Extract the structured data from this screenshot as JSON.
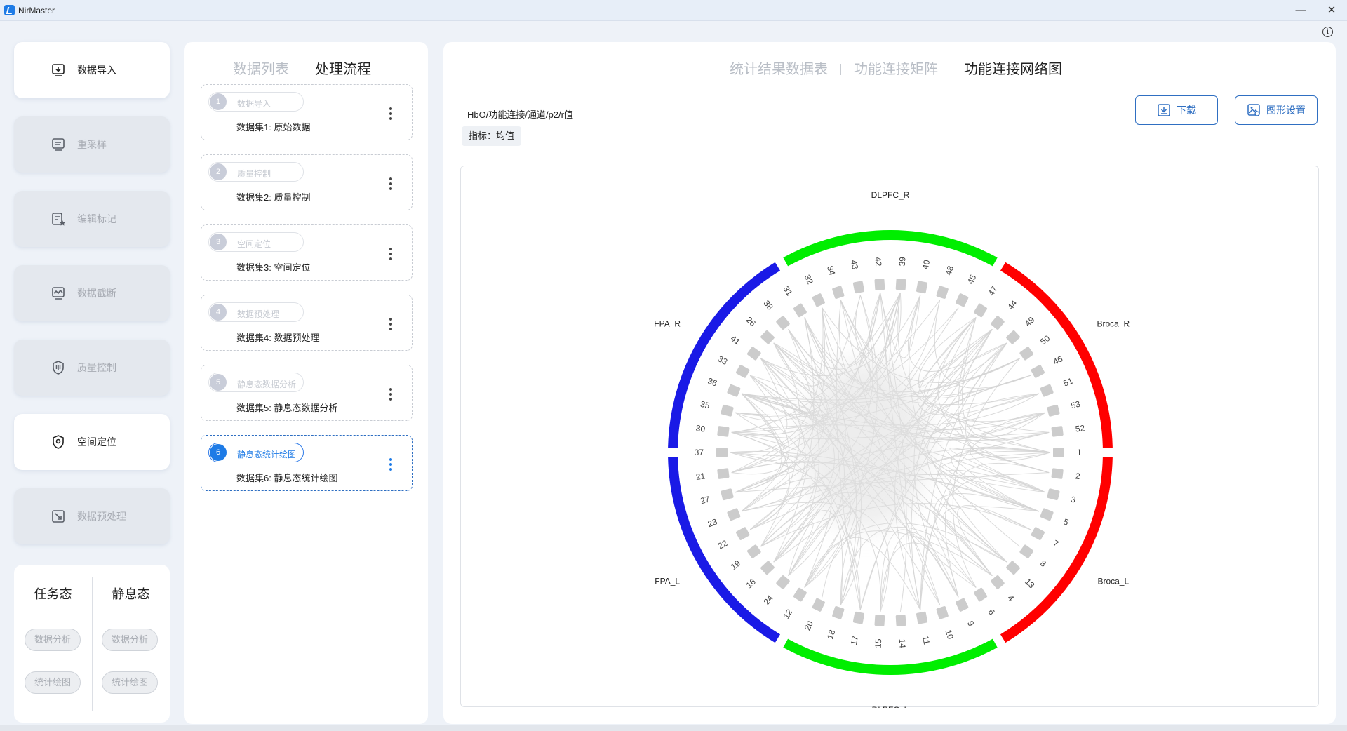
{
  "app": {
    "title": "NirMaster"
  },
  "window": {
    "minimize_glyph": "—",
    "close_glyph": "✕",
    "info_glyph": "i"
  },
  "sidebar": {
    "items": [
      {
        "label": "数据导入",
        "icon": "import-icon",
        "state": "active"
      },
      {
        "label": "重采样",
        "icon": "resample-icon",
        "state": "disabled"
      },
      {
        "label": "编辑标记",
        "icon": "edit-marker-icon",
        "state": "disabled"
      },
      {
        "label": "数据截断",
        "icon": "truncate-icon",
        "state": "disabled"
      },
      {
        "label": "质量控制",
        "icon": "shield-icon",
        "state": "disabled"
      },
      {
        "label": "空间定位",
        "icon": "location-icon",
        "state": "active"
      },
      {
        "label": "数据预处理",
        "icon": "preprocess-icon",
        "state": "disabled"
      }
    ]
  },
  "mode": {
    "task": {
      "title": "任务态",
      "analysis": "数据分析",
      "plot": "统计绘图"
    },
    "rest": {
      "title": "静息态",
      "analysis": "数据分析",
      "plot": "统计绘图"
    }
  },
  "flow": {
    "tabs": [
      "数据列表",
      "处理流程"
    ],
    "active_tab": 1,
    "steps": [
      {
        "num": "1",
        "label": "数据导入",
        "name": "数据集1: 原始数据",
        "active": false
      },
      {
        "num": "2",
        "label": "质量控制",
        "name": "数据集2: 质量控制",
        "active": false
      },
      {
        "num": "3",
        "label": "空间定位",
        "name": "数据集3: 空间定位",
        "active": false
      },
      {
        "num": "4",
        "label": "数据预处理",
        "name": "数据集4: 数据预处理",
        "active": false
      },
      {
        "num": "5",
        "label": "静息态数据分析",
        "name": "数据集5: 静息态数据分析",
        "active": false
      },
      {
        "num": "6",
        "label": "静息态统计绘图",
        "name": "数据集6: 静息态统计绘图",
        "active": true
      }
    ]
  },
  "main": {
    "tabs": [
      "统计结果数据表",
      "功能连接矩阵",
      "功能连接网络图"
    ],
    "active_tab": 2,
    "path": "HbO/功能连接/通道/p2/r值",
    "metric": "指标：均值",
    "download_label": "下载",
    "settings_label": "图形设置"
  },
  "chart_data": {
    "type": "chord",
    "regions": [
      {
        "name": "Broca_R",
        "color": "#ff0000",
        "start_deg": 0,
        "end_deg": 60
      },
      {
        "name": "DLPFC_R",
        "color": "#00ee00",
        "start_deg": 60,
        "end_deg": 120
      },
      {
        "name": "FPA_R",
        "color": "#1a1ae6",
        "start_deg": 120,
        "end_deg": 180
      },
      {
        "name": "FPA_L",
        "color": "#1a1ae6",
        "start_deg": 180,
        "end_deg": 240
      },
      {
        "name": "DLPFC_L",
        "color": "#00ee00",
        "start_deg": 240,
        "end_deg": 300
      },
      {
        "name": "Broca_L",
        "color": "#ff0000",
        "start_deg": 300,
        "end_deg": 360
      }
    ],
    "node_order_ccw_from_right": [
      "1",
      "52",
      "53",
      "51",
      "46",
      "50",
      "49",
      "44",
      "47",
      "45",
      "48",
      "40",
      "39",
      "42",
      "43",
      "34",
      "32",
      "31",
      "38",
      "26",
      "41",
      "33",
      "36",
      "35",
      "30",
      "37",
      "21",
      "27",
      "23",
      "22",
      "19",
      "16",
      "24",
      "12",
      "20",
      "18",
      "17",
      "15",
      "14",
      "11",
      "10",
      "9",
      "6",
      "4",
      "13",
      "8",
      "7",
      "5",
      "3",
      "2"
    ],
    "edge_color": "#d4d4d4",
    "node_color": "#cccccc"
  }
}
